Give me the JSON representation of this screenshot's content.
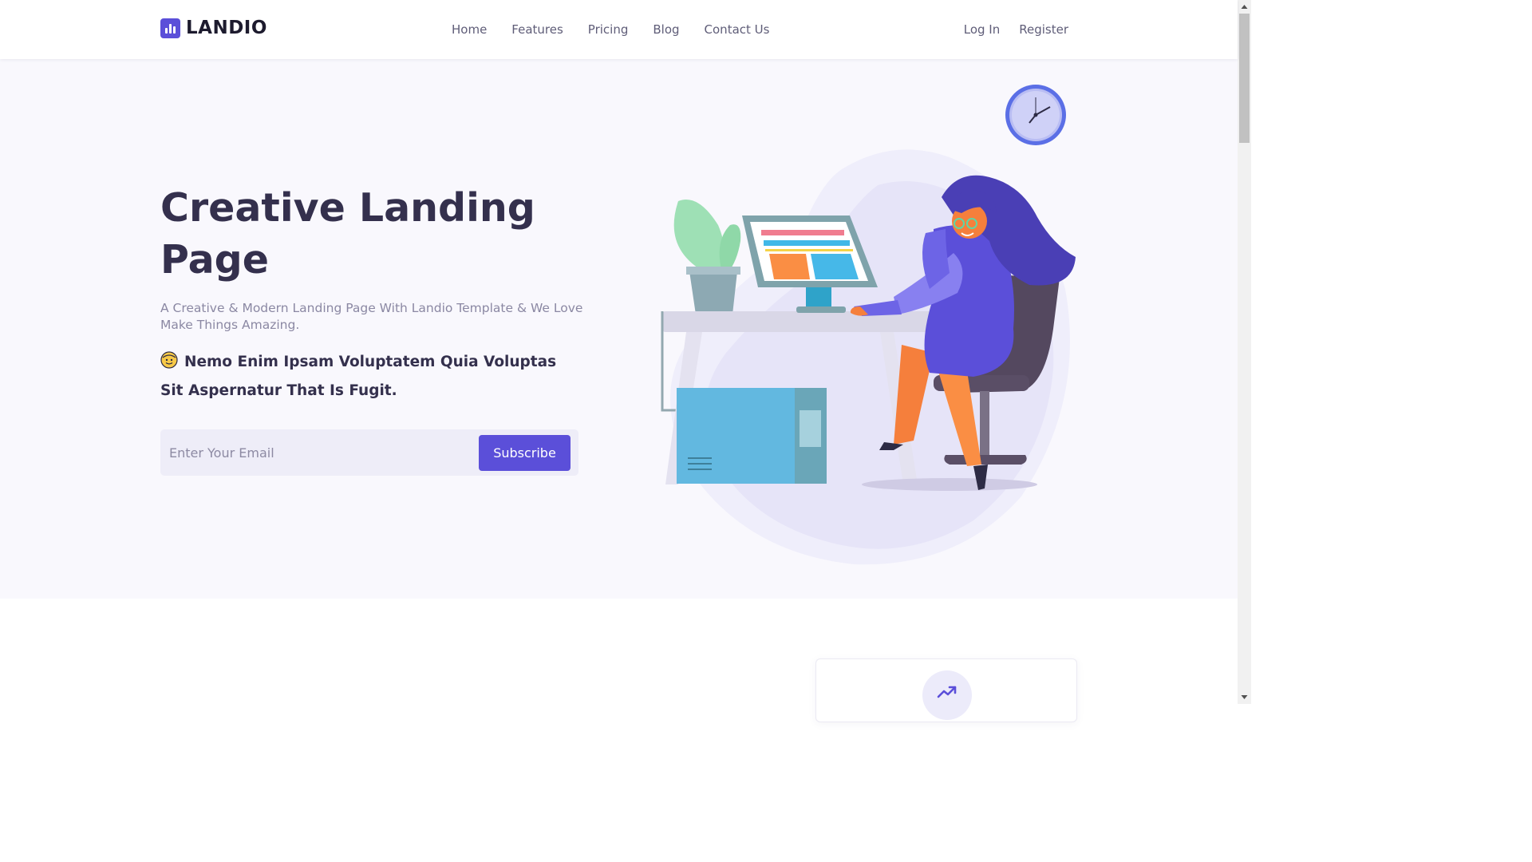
{
  "brand": {
    "name": "LANDIO",
    "color": "#5b4fd9"
  },
  "nav": {
    "items": [
      {
        "label": "Home"
      },
      {
        "label": "Features"
      },
      {
        "label": "Pricing"
      },
      {
        "label": "Blog"
      },
      {
        "label": "Contact Us"
      }
    ]
  },
  "auth": {
    "login": "Log In",
    "register": "Register"
  },
  "hero": {
    "title": "Creative Landing Page",
    "subtitle": "A Creative & Modern Landing Page With Landio Template & We Love Make Things Amazing.",
    "tagline": "Nemo Enim Ipsam Voluptatem Quia Voluptas Sit Aspernatur That Is Fugit.",
    "tagline_icon": "smiling-face-emoji-icon",
    "illustration": "woman-working-at-desk-illustration",
    "clock_icon": "wall-clock-icon"
  },
  "subscribe": {
    "placeholder": "Enter Your Email",
    "button": "Subscribe"
  },
  "features": {
    "icon": "trending-up-icon"
  },
  "colors": {
    "accent": "#5b4fd9",
    "hero_bg": "#f9f8fd",
    "text_dark": "#34304d",
    "text_muted": "#8b88a3"
  }
}
